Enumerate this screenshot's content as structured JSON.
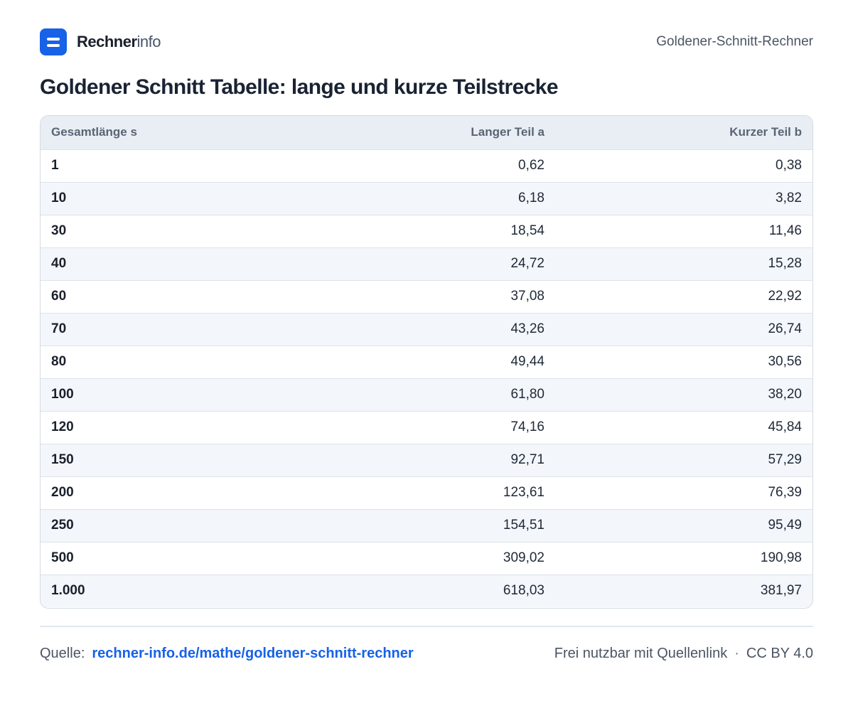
{
  "brand": {
    "name_strong": "Rechner",
    "name_light": "info"
  },
  "header": {
    "right_label": "Goldener-Schnitt-Rechner"
  },
  "title": "Goldener Schnitt Tabelle: lange und kurze Teilstrecke",
  "table": {
    "columns": [
      "Gesamtlänge s",
      "Langer Teil a",
      "Kurzer Teil b"
    ],
    "rows": [
      [
        "1",
        "0,62",
        "0,38"
      ],
      [
        "10",
        "6,18",
        "3,82"
      ],
      [
        "30",
        "18,54",
        "11,46"
      ],
      [
        "40",
        "24,72",
        "15,28"
      ],
      [
        "60",
        "37,08",
        "22,92"
      ],
      [
        "70",
        "43,26",
        "26,74"
      ],
      [
        "80",
        "49,44",
        "30,56"
      ],
      [
        "100",
        "61,80",
        "38,20"
      ],
      [
        "120",
        "74,16",
        "45,84"
      ],
      [
        "150",
        "92,71",
        "57,29"
      ],
      [
        "200",
        "123,61",
        "76,39"
      ],
      [
        "250",
        "154,51",
        "95,49"
      ],
      [
        "500",
        "309,02",
        "190,98"
      ],
      [
        "1.000",
        "618,03",
        "381,97"
      ]
    ]
  },
  "footer": {
    "source_label": "Quelle:",
    "source_link": "rechner-info.de/mathe/goldener-schnitt-rechner",
    "license_text": "Frei nutzbar mit Quellenlink",
    "separator": "·",
    "license": "CC BY 4.0"
  },
  "colors": {
    "accent": "#1762e6",
    "header_bg": "#e9eef5",
    "stripe": "#f3f6fa"
  }
}
